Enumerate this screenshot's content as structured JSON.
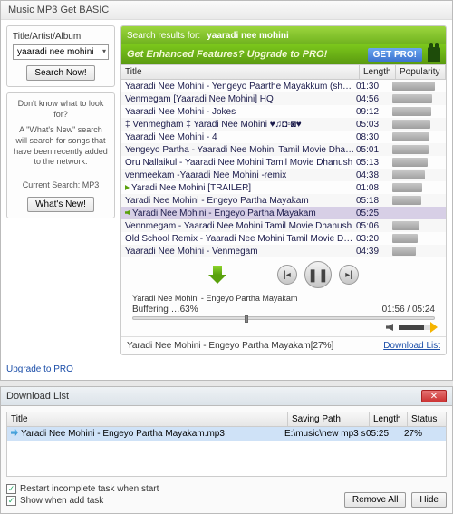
{
  "window": {
    "title": "Music MP3 Get BASIC"
  },
  "side": {
    "search_label": "Title/Artist/Album",
    "search_value": "yaaradi nee mohini",
    "search_now_btn": "Search Now!",
    "hint_title": "Don't know what to look for?",
    "hint_body": "A \"What's New\" search will search for songs that have been recently added to the network.",
    "current_search_label": "Current Search: MP3",
    "whats_new_btn": "What's New!",
    "upgrade_link": "Upgrade to PRO"
  },
  "results": {
    "header_prefix": "Search results for:",
    "header_query": "yaaradi nee mohini",
    "promo_text": "Get Enhanced Features? Upgrade to PRO!",
    "getpro_btn": "GET PRO!",
    "columns": {
      "title": "Title",
      "length": "Length",
      "popularity": "Popularity"
    },
    "rows": [
      {
        "title": "Yaaradi Nee Mohini - Yengeyo Paarthe Mayakkum (short vi…",
        "length": "01:30",
        "pop": 85
      },
      {
        "title": "Venmegam [Yaaradi Nee Mohini] HQ",
        "length": "04:56",
        "pop": 80
      },
      {
        "title": "Yaaradi Nee Mohini - Jokes",
        "length": "09:12",
        "pop": 78
      },
      {
        "title": "‡ Venmegham ‡ Yaradi Nee Mohini ♥♫◘▫◙♥",
        "length": "05:03",
        "pop": 76
      },
      {
        "title": "Yaaradi Nee Mohini - 4",
        "length": "08:30",
        "pop": 74
      },
      {
        "title": "Yengeyo Partha - Yaaradi Nee Mohini Tamil Movie Dhanush",
        "length": "05:01",
        "pop": 72
      },
      {
        "title": "Oru Nallaikul - Yaaradi Nee Mohini Tamil Movie Dhanush",
        "length": "05:13",
        "pop": 70
      },
      {
        "title": "venmeekam -Yaaradi Nee Mohini -remix",
        "length": "04:38",
        "pop": 66
      },
      {
        "title": "Yaradi Nee Mohini [TRAILER]",
        "length": "01:08",
        "pop": 60,
        "playing_small": true
      },
      {
        "title": "Yaradi Nee Mohini - Engeyo Partha Mayakam",
        "length": "05:18",
        "pop": 58
      },
      {
        "title": "Yaradi Nee Mohini - Engeyo Partha Mayakam",
        "length": "05:25",
        "pop": 0,
        "selected": true,
        "speaker": true
      },
      {
        "title": "Vennmegam - Yaaradi Nee Mohini Tamil Movie Dhanush",
        "length": "05:06",
        "pop": 54
      },
      {
        "title": "Old School Remix - Yaaradi Nee Mohini Tamil Movie Dhanu…",
        "length": "03:20",
        "pop": 50
      },
      {
        "title": "Yaaradi Nee Mohini - Venmegam",
        "length": "04:39",
        "pop": 48
      }
    ]
  },
  "player": {
    "now_playing": "Yaradi Nee Mohini - Engeyo Partha Mayakam",
    "buffering_text": "Buffering …63%",
    "time_text": "01:56 / 05:24",
    "status_text": "Yaradi Nee Mohini - Engeyo Partha Mayakam[27%]",
    "download_list_link": "Download List"
  },
  "dlwin": {
    "title": "Download List",
    "columns": {
      "title": "Title",
      "saving_path": "Saving Path",
      "length": "Length",
      "status": "Status"
    },
    "rows": [
      {
        "title": "Yaradi Nee Mohini - Engeyo Partha Mayakam.mp3",
        "path": "E:\\music\\new mp3 s…",
        "length": "05:25",
        "status": "27%"
      }
    ],
    "opt_restart": "Restart incomplete task when start",
    "opt_show": "Show when add task",
    "remove_all_btn": "Remove All",
    "hide_btn": "Hide"
  }
}
